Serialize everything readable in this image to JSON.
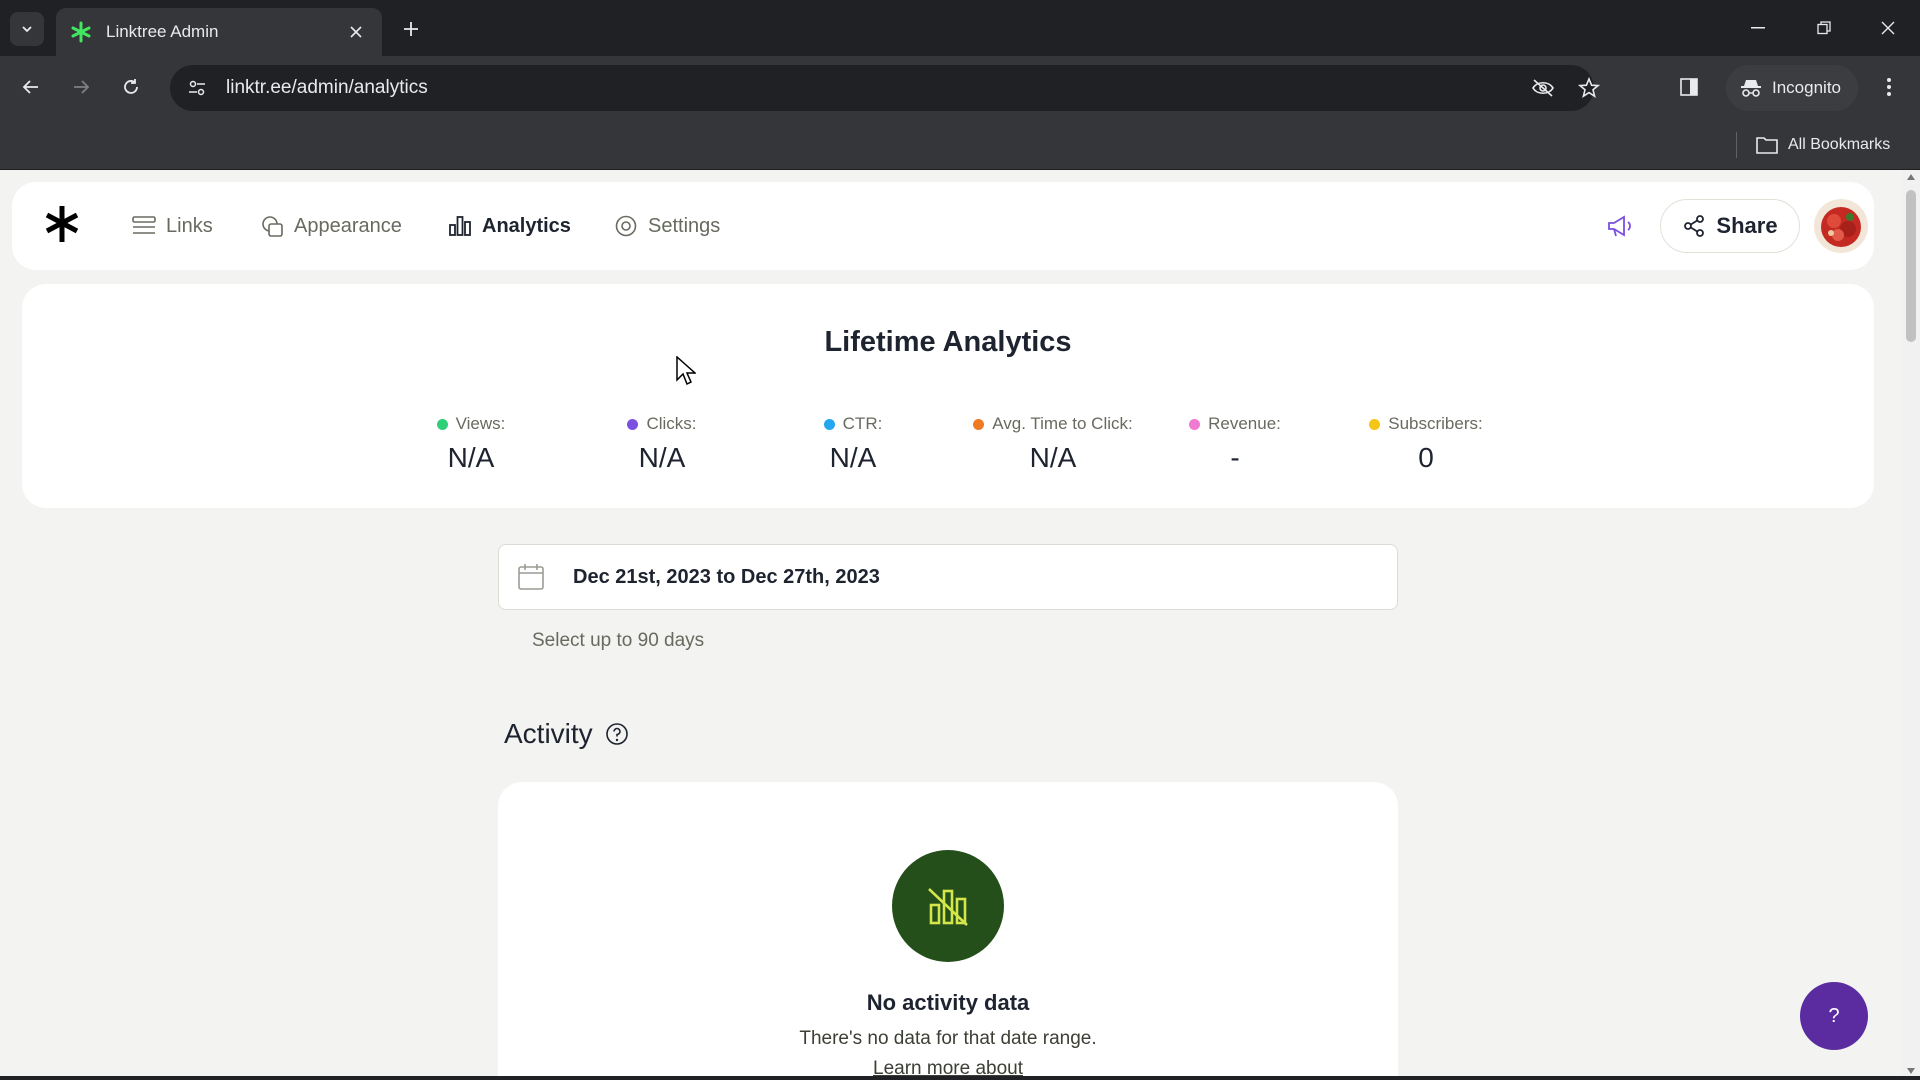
{
  "browser": {
    "tab_title": "Linktree Admin",
    "url": "linktr.ee/admin/analytics",
    "incognito_label": "Incognito",
    "all_bookmarks_label": "All Bookmarks"
  },
  "nav": {
    "items": [
      {
        "label": "Links",
        "icon": "links-icon"
      },
      {
        "label": "Appearance",
        "icon": "appearance-icon"
      },
      {
        "label": "Analytics",
        "icon": "analytics-icon",
        "active": true
      },
      {
        "label": "Settings",
        "icon": "settings-icon"
      }
    ],
    "share_label": "Share"
  },
  "lifetime": {
    "title": "Lifetime Analytics",
    "stats": [
      {
        "label": "Views:",
        "value": "N/A",
        "color": "#2fcf7a"
      },
      {
        "label": "Clicks:",
        "value": "N/A",
        "color": "#7b4fe0"
      },
      {
        "label": "CTR:",
        "value": "N/A",
        "color": "#22a7f0"
      },
      {
        "label": "Avg. Time to Click:",
        "value": "N/A",
        "color": "#f07a22"
      },
      {
        "label": "Revenue:",
        "value": "-",
        "color": "#f07ad0"
      },
      {
        "label": "Subscribers:",
        "value": "0",
        "color": "#f5c518"
      }
    ]
  },
  "date_range": {
    "text": "Dec 21st, 2023 to Dec 27th, 2023",
    "hint": "Select up to 90 days"
  },
  "activity": {
    "title": "Activity",
    "empty_title": "No activity data",
    "empty_desc": "There's no data for that date range.",
    "learn_more": "Learn more about"
  },
  "help_fab_label": "?",
  "colors": {
    "accent_purple": "#5a2ca0",
    "empty_circle": "#254f1a",
    "empty_icon": "#d4e64a"
  }
}
